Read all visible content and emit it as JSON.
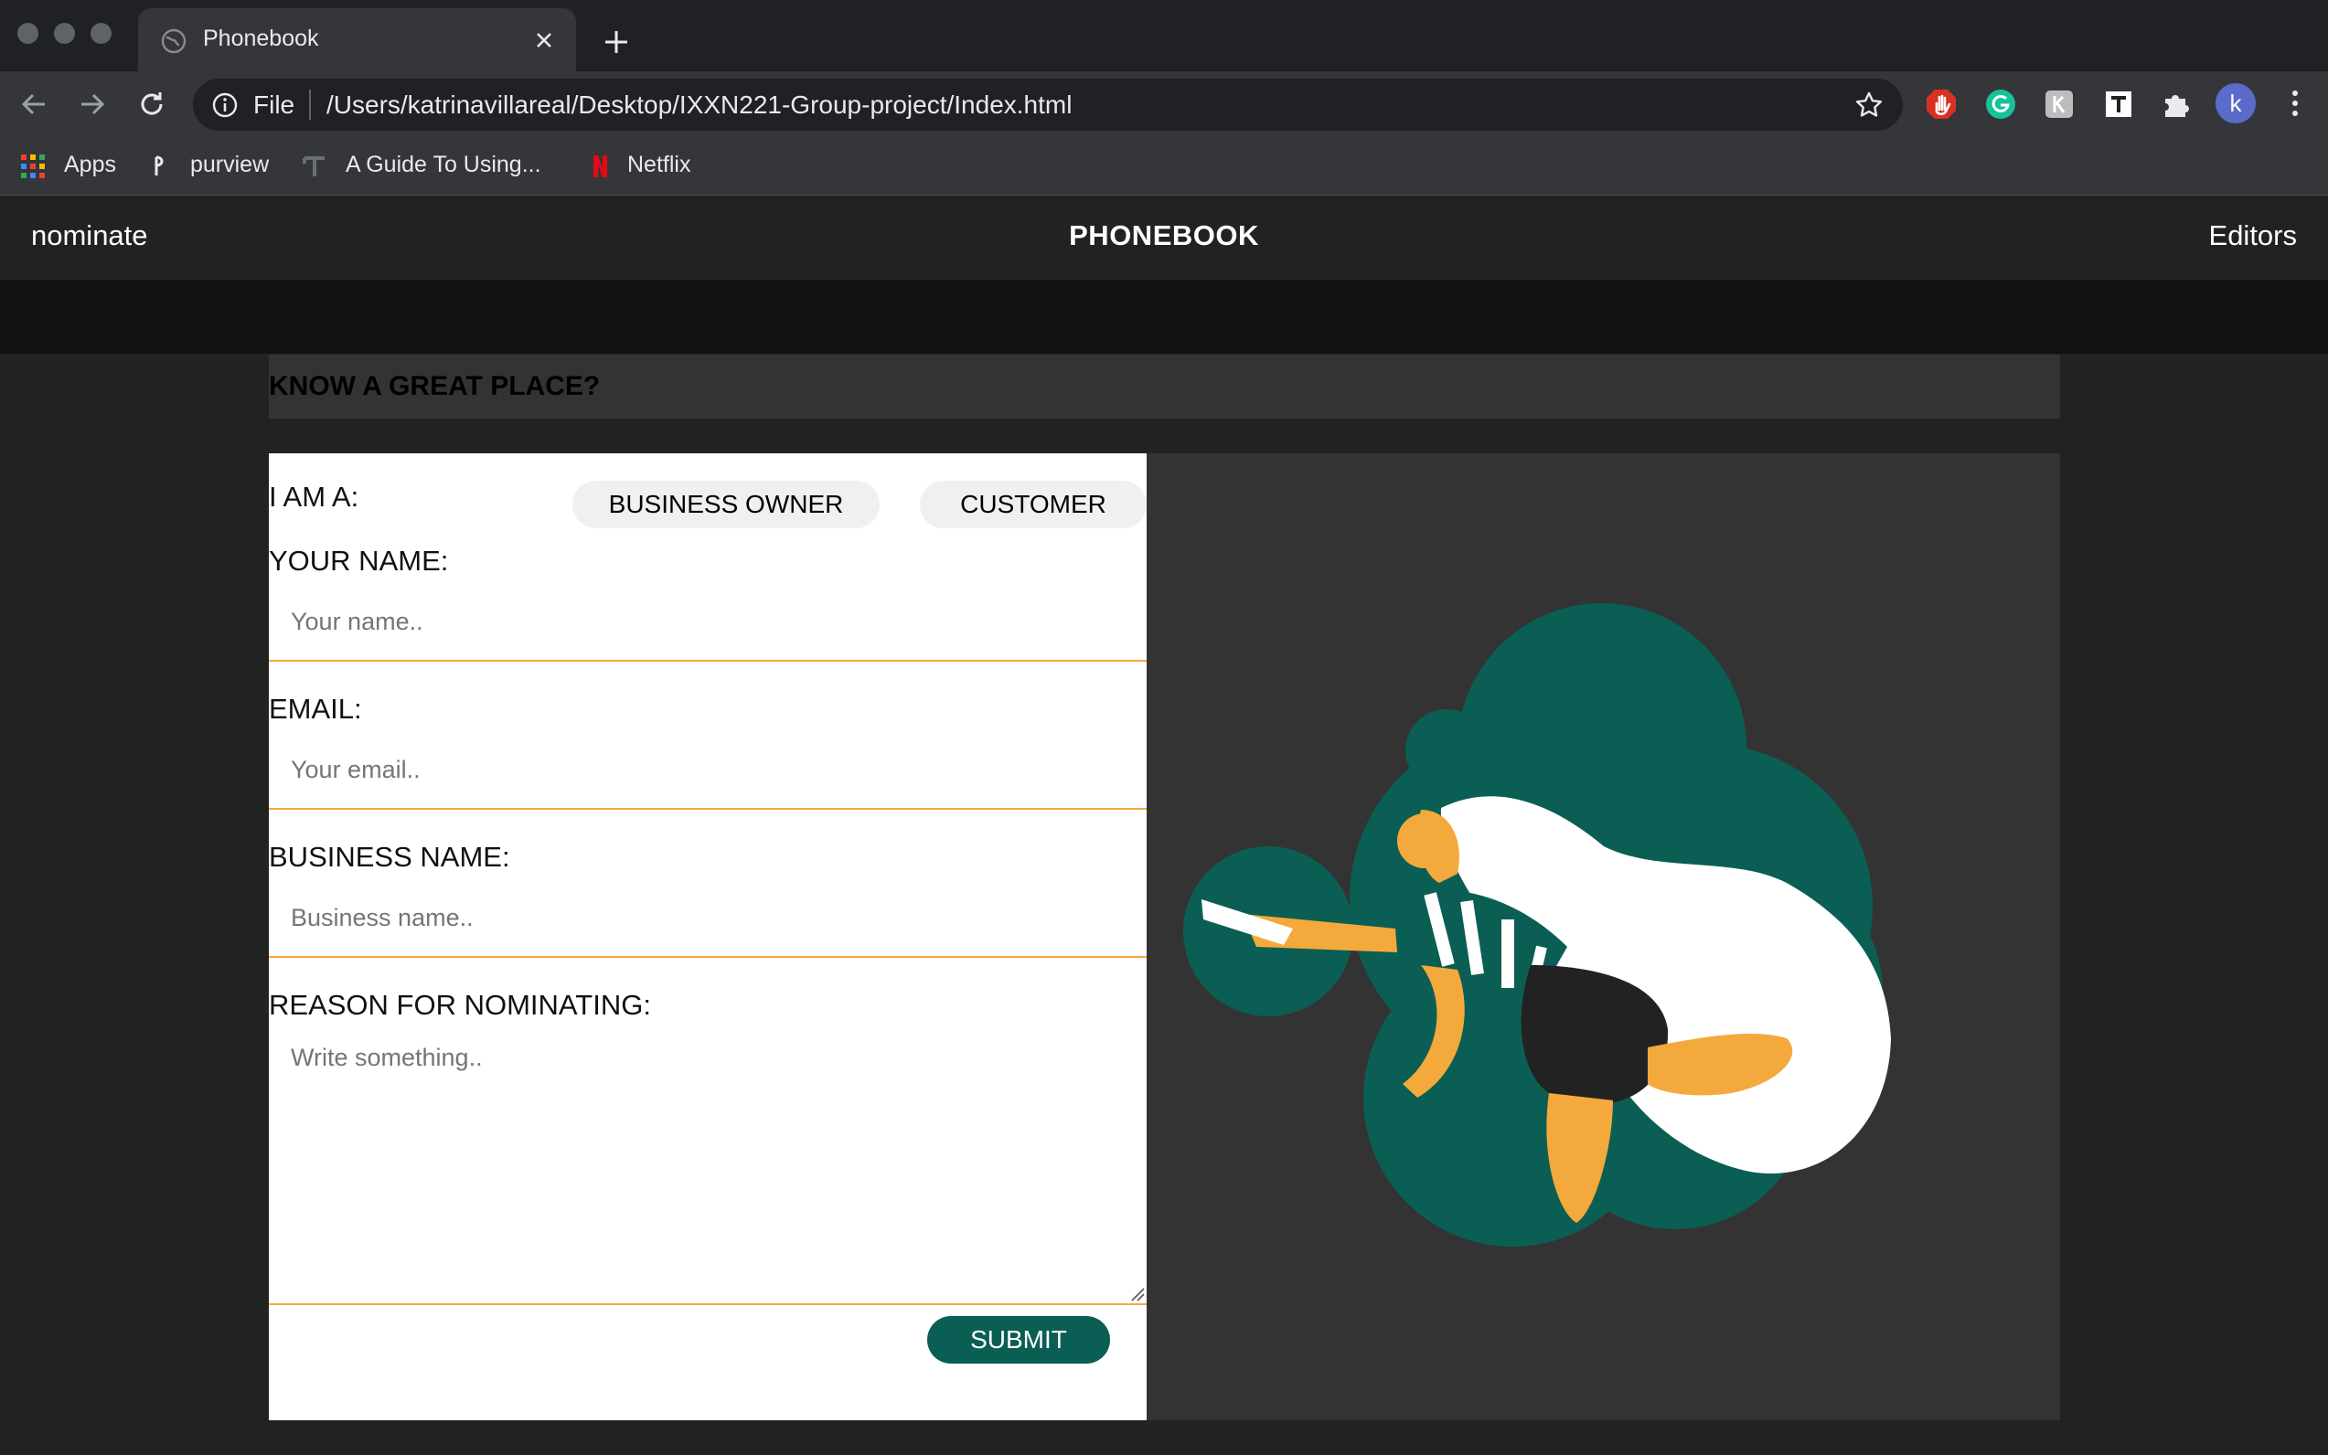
{
  "browser": {
    "tab_title": "Phonebook",
    "file_label": "File",
    "url": "/Users/katrinavillareal/Desktop/IXXN221-Group-project/Index.html",
    "profile_initial": "k",
    "bookmarks": [
      {
        "label": "Apps",
        "icon": "apps-grid-icon"
      },
      {
        "label": "purview",
        "icon": "purview-icon"
      },
      {
        "label": "A Guide To Using...",
        "icon": "guide-icon"
      },
      {
        "label": "Netflix",
        "icon": "netflix-icon"
      }
    ],
    "extensions": [
      "adblock-icon",
      "grammarly-icon",
      "kami-icon",
      "typora-icon",
      "puzzle-icon"
    ]
  },
  "site": {
    "nav_left": "nominate",
    "brand": "PHONEBOOK",
    "nav_right": "Editors",
    "banner": "KNOW A GREAT PLACE?"
  },
  "form": {
    "role_label": "I AM A:",
    "role_options": [
      "BUSINESS OWNER",
      "CUSTOMER"
    ],
    "name_label": "YOUR NAME:",
    "name_placeholder": "Your name..",
    "email_label": "EMAIL:",
    "email_placeholder": "Your email..",
    "business_label": "BUSINESS NAME:",
    "business_placeholder": "Business name..",
    "reason_label": "REASON FOR NOMINATING:",
    "reason_placeholder": "Write something..",
    "submit_label": "SUBMIT"
  },
  "colors": {
    "accent_teal": "#0b5e53",
    "accent_orange": "#f4a93c",
    "panel_dark": "#333333"
  }
}
